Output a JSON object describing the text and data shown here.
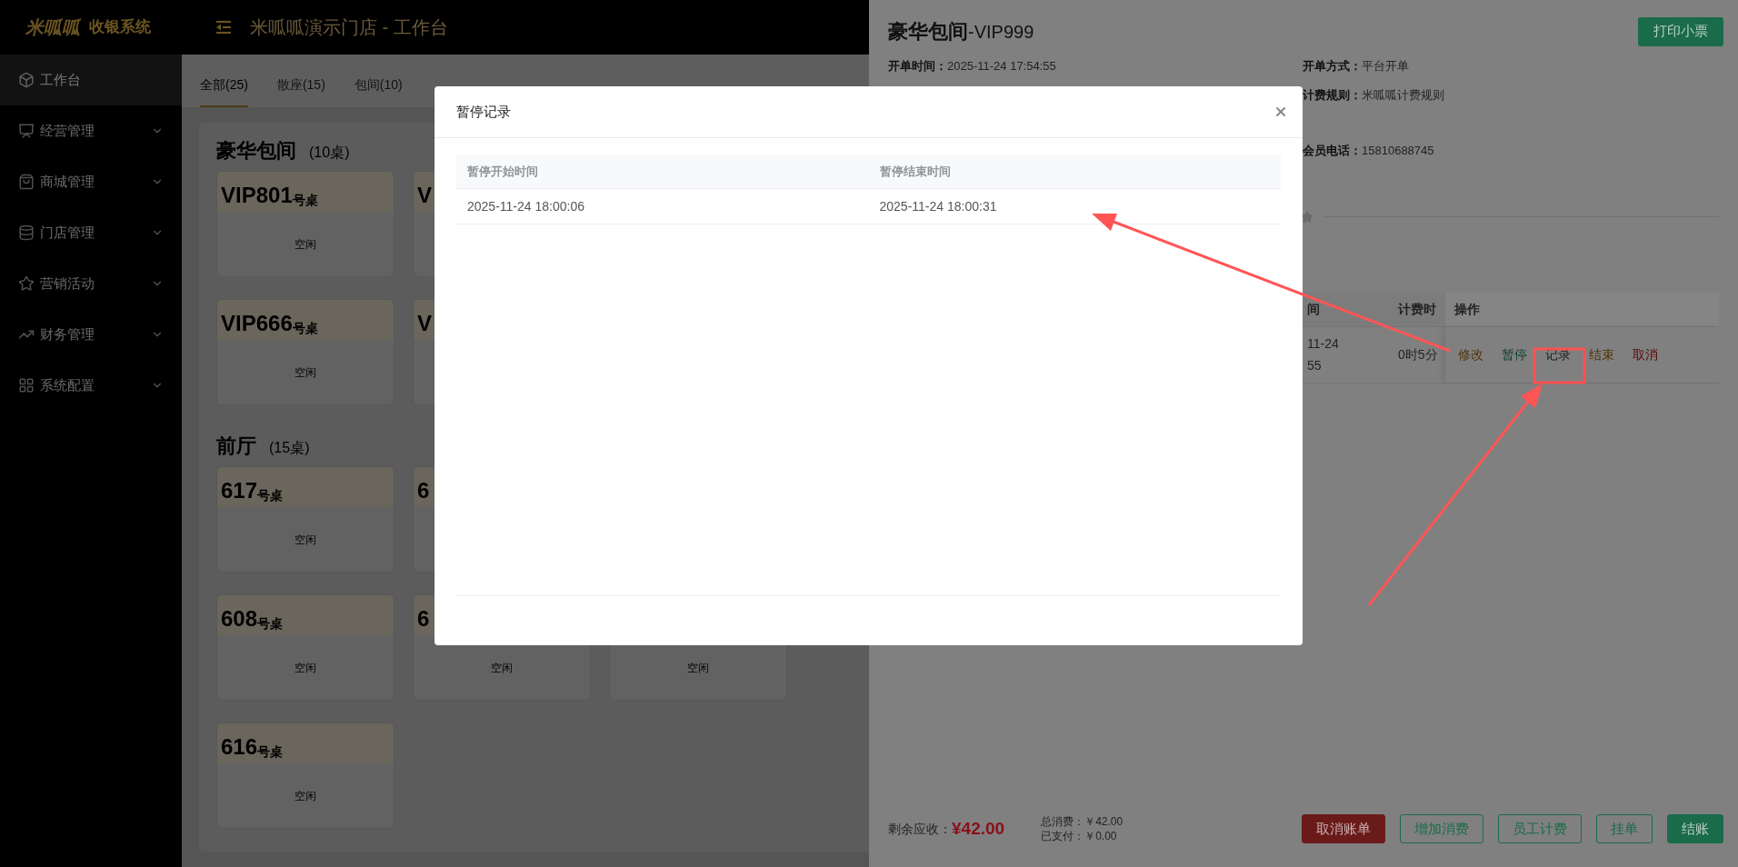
{
  "header": {
    "logo": "米呱呱",
    "system_name": "收银系统",
    "title": "米呱呱演示门店 - 工作台"
  },
  "sidebar": {
    "items": [
      {
        "label": "工作台",
        "selected": true,
        "expandable": false
      },
      {
        "label": "经营管理",
        "selected": false,
        "expandable": true
      },
      {
        "label": "商城管理",
        "selected": false,
        "expandable": true
      },
      {
        "label": "门店管理",
        "selected": false,
        "expandable": true
      },
      {
        "label": "营销活动",
        "selected": false,
        "expandable": true
      },
      {
        "label": "财务管理",
        "selected": false,
        "expandable": true
      },
      {
        "label": "系统配置",
        "selected": false,
        "expandable": true
      }
    ]
  },
  "tabs": [
    {
      "label": "全部(25)",
      "selected": true
    },
    {
      "label": "散座(15)",
      "selected": false
    },
    {
      "label": "包间(10)",
      "selected": false
    }
  ],
  "sections": [
    {
      "title": "豪华包间",
      "count": "(10桌)",
      "rows": [
        [
          {
            "name": "VIP801",
            "suffix": "号桌",
            "status": "空闲"
          },
          {
            "name": "V"
          }
        ],
        [
          {
            "name": "VIP666",
            "suffix": "号桌",
            "status": "空闲"
          },
          {
            "name": "V"
          }
        ]
      ]
    },
    {
      "title": "前厅",
      "count": "(15桌)",
      "rows": [
        [
          {
            "name": "617",
            "suffix": "号桌",
            "status": "空闲"
          },
          {
            "name": "6"
          }
        ],
        [
          {
            "name": "608",
            "suffix": "号桌",
            "status": "空闲"
          },
          {
            "name": "6",
            "status": "空闲"
          },
          {
            "status": "空闲"
          }
        ],
        [
          {
            "name": "616",
            "suffix": "号桌",
            "status": "空闲"
          }
        ]
      ]
    }
  ],
  "drawer": {
    "title": "豪华包间",
    "title_suffix": "-VIP999",
    "print_button": "打印小票",
    "left_fields": [
      {
        "label": "开单时间：",
        "value": "2025-11-24 17:54:55"
      }
    ],
    "right_fields": [
      {
        "label": "开单方式：",
        "value": "平台开单"
      },
      {
        "label": "计费规则：",
        "value": "米呱呱计费规则"
      },
      {
        "label": "会员电话：",
        "value": "15810688745"
      }
    ],
    "table": {
      "columns": [
        "间",
        "计费时",
        "操作"
      ],
      "rows": [
        {
          "time_lines": [
            "11-24",
            "55"
          ],
          "duration": "0时5分",
          "actions": [
            {
              "label": "修改",
              "kind": "edit"
            },
            {
              "label": "暂停",
              "kind": "pause"
            },
            {
              "label": "记录",
              "kind": "record"
            },
            {
              "label": "结束",
              "kind": "end"
            },
            {
              "label": "取消",
              "kind": "cancel"
            }
          ]
        }
      ]
    },
    "footer": {
      "due_label": "剩余应收：",
      "due": "¥42.00",
      "total": "总消费：￥42.00",
      "paid": "已支付：￥0.00",
      "buttons": [
        {
          "label": "取消账单",
          "kind": "danger"
        },
        {
          "label": "增加消费",
          "kind": "outline"
        },
        {
          "label": "员工计费",
          "kind": "outline"
        },
        {
          "label": "挂单",
          "kind": "outline"
        },
        {
          "label": "结账",
          "kind": "primary"
        }
      ]
    }
  },
  "modal": {
    "title": "暂停记录",
    "columns": [
      "暂停开始时间",
      "暂停结束时间"
    ],
    "rows": [
      [
        "2025-11-24 18:00:06",
        "2025-11-24 18:00:31"
      ]
    ]
  }
}
